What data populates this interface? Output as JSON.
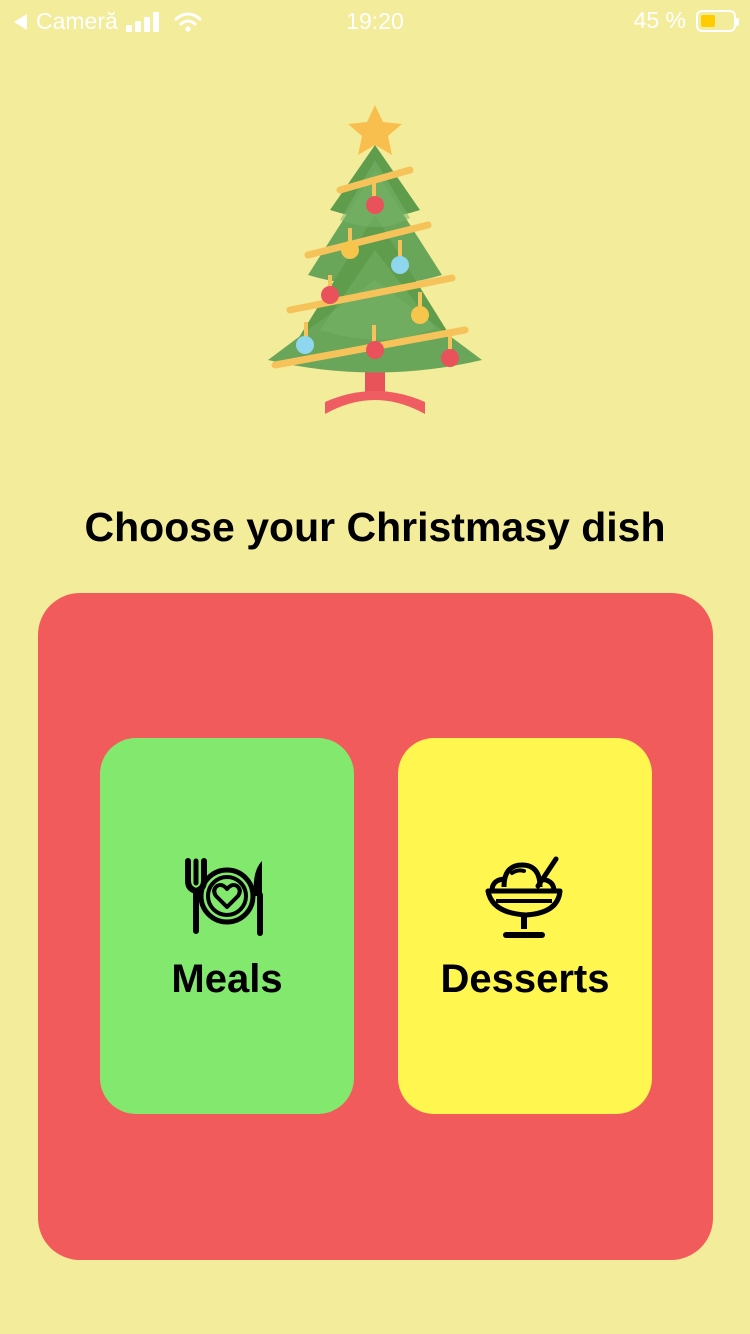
{
  "status_bar": {
    "back_label": "Cameră",
    "time": "19:20",
    "battery_text": "45 %",
    "battery_level": 0.45
  },
  "headline": "Choose your Christmasy dish",
  "cards": {
    "meals": {
      "label": "Meals",
      "icon": "meal-plate-icon",
      "color": "#82e96e"
    },
    "desserts": {
      "label": "Desserts",
      "icon": "ice-cream-sundae-icon",
      "color": "#fff64f"
    }
  },
  "colors": {
    "background": "#f3ec9b",
    "panel": "#f25b5b"
  }
}
